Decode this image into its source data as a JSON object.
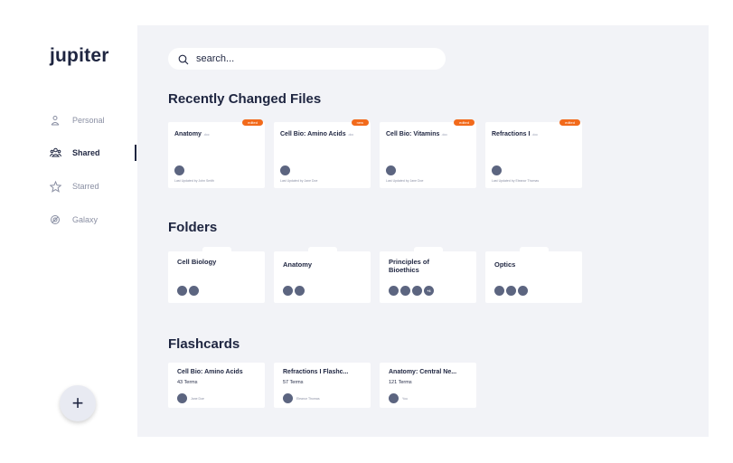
{
  "app": {
    "name": "jupiter"
  },
  "sidebar": {
    "items": [
      {
        "label": "Personal",
        "icon": "person-icon"
      },
      {
        "label": "Shared",
        "icon": "people-icon",
        "active": true
      },
      {
        "label": "Starred",
        "icon": "star-icon"
      },
      {
        "label": "Galaxy",
        "icon": "galaxy-icon"
      }
    ],
    "add_button": {
      "label": "+"
    }
  },
  "search": {
    "placeholder": "search..."
  },
  "recent": {
    "title": "Recently Changed Files",
    "files": [
      {
        "title": "Anatomy",
        "ext": ".doc",
        "badge": "edited",
        "updated": "Last Updated by John Smith"
      },
      {
        "title": "Cell Bio: Amino Acids",
        "ext": ".doc",
        "badge": "new",
        "updated": "Last Updated by Jane Doe"
      },
      {
        "title": "Cell Bio: Vitamins",
        "ext": ".doc",
        "badge": "edited",
        "updated": "Last Updated by Jane Doe"
      },
      {
        "title": "Refractions I",
        "ext": ".doc",
        "badge": "edited",
        "updated": "Last Updated by Eleanor Thomas"
      }
    ]
  },
  "folders": {
    "title": "Folders",
    "items": [
      {
        "name": "Cell Biology",
        "avatars": 2
      },
      {
        "name": "Anatomy",
        "avatars": 2
      },
      {
        "name": "Principles of Bioethics",
        "avatars": 3,
        "more": "+4"
      },
      {
        "name": "Optics",
        "avatars": 3
      }
    ]
  },
  "flashcards": {
    "title": "Flashcards",
    "items": [
      {
        "title": "Cell Bio: Amino Acids",
        "terms": "43 Terms",
        "author": "Jane Doe"
      },
      {
        "title": "Refractions I Flashc...",
        "terms": "57 Terms",
        "author": "Eleanor Thomas"
      },
      {
        "title": "Anatomy: Central Ne...",
        "terms": "121 Terms",
        "author": "You"
      }
    ]
  },
  "colors": {
    "navy": "#1e2540",
    "accent": "#f26a1b",
    "panel": "#f2f3f7",
    "avatar": "#5c6580"
  }
}
